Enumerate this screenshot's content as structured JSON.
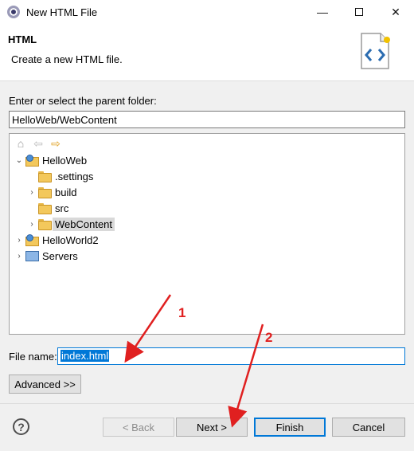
{
  "window": {
    "title": "New HTML File"
  },
  "header": {
    "title": "HTML",
    "description": "Create a new HTML file."
  },
  "folder": {
    "label": "Enter or select the parent folder:",
    "value": "HelloWeb/WebContent"
  },
  "tree": {
    "items": [
      {
        "label": "HelloWeb",
        "icon": "project-icon",
        "expanded": true
      },
      {
        "label": ".settings",
        "icon": "folder-icon"
      },
      {
        "label": "build",
        "icon": "folder-icon"
      },
      {
        "label": "src",
        "icon": "folder-icon"
      },
      {
        "label": "WebContent",
        "icon": "folder-icon",
        "selected": true
      },
      {
        "label": "HelloWorld2",
        "icon": "project-icon"
      },
      {
        "label": "Servers",
        "icon": "servers-folder-icon"
      }
    ]
  },
  "filename": {
    "label": "File name:",
    "value": "index.html"
  },
  "buttons": {
    "advanced": "Advanced >>",
    "back": "< Back",
    "next": "Next >",
    "finish": "Finish",
    "cancel": "Cancel",
    "help": "?"
  },
  "annotations": {
    "first": "1",
    "second": "2",
    "color": "#e02020"
  }
}
